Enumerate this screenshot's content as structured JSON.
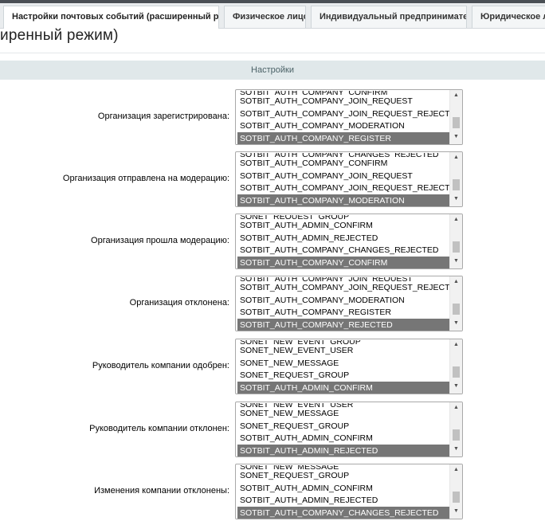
{
  "tabs": [
    {
      "label": "Настройки почтовых событий (расширенный режим)",
      "active": true
    },
    {
      "label": "Физическое лицо",
      "active": false
    },
    {
      "label": "Индивидуальный предприниматель",
      "active": false
    },
    {
      "label": "Юридическое лицо",
      "active": false
    }
  ],
  "page_title": "иренный режим)",
  "section_title": "Настройки",
  "rows": [
    {
      "label": "Организация зарегистрирована:",
      "partial": "SOTBIT_AUTH_COMPANY_CONFIRM",
      "options": [
        "SOTBIT_AUTH_COMPANY_JOIN_REQUEST",
        "SOTBIT_AUTH_COMPANY_JOIN_REQUEST_REJECTED",
        "SOTBIT_AUTH_COMPANY_MODERATION",
        "SOTBIT_AUTH_COMPANY_REGISTER"
      ],
      "selected": "SOTBIT_AUTH_COMPANY_REGISTER"
    },
    {
      "label": "Организация отправлена на модерацию:",
      "partial": "SOTBIT_AUTH_COMPANY_CHANGES_REJECTED",
      "options": [
        "SOTBIT_AUTH_COMPANY_CONFIRM",
        "SOTBIT_AUTH_COMPANY_JOIN_REQUEST",
        "SOTBIT_AUTH_COMPANY_JOIN_REQUEST_REJECTED",
        "SOTBIT_AUTH_COMPANY_MODERATION"
      ],
      "selected": "SOTBIT_AUTH_COMPANY_MODERATION"
    },
    {
      "label": "Организация прошла модерацию:",
      "partial": "SONET_REQUEST_GROUP",
      "options": [
        "SOTBIT_AUTH_ADMIN_CONFIRM",
        "SOTBIT_AUTH_ADMIN_REJECTED",
        "SOTBIT_AUTH_COMPANY_CHANGES_REJECTED",
        "SOTBIT_AUTH_COMPANY_CONFIRM"
      ],
      "selected": "SOTBIT_AUTH_COMPANY_CONFIRM"
    },
    {
      "label": "Организация отклонена:",
      "partial": "SOTBIT_AUTH_COMPANY_JOIN_REQUEST",
      "options": [
        "SOTBIT_AUTH_COMPANY_JOIN_REQUEST_REJECTED",
        "SOTBIT_AUTH_COMPANY_MODERATION",
        "SOTBIT_AUTH_COMPANY_REGISTER",
        "SOTBIT_AUTH_COMPANY_REJECTED"
      ],
      "selected": "SOTBIT_AUTH_COMPANY_REJECTED"
    },
    {
      "label": "Руководитель компании одобрен:",
      "partial": "SONET_NEW_EVENT_GROUP",
      "options": [
        "SONET_NEW_EVENT_USER",
        "SONET_NEW_MESSAGE",
        "SONET_REQUEST_GROUP",
        "SOTBIT_AUTH_ADMIN_CONFIRM"
      ],
      "selected": "SOTBIT_AUTH_ADMIN_CONFIRM"
    },
    {
      "label": "Руководитель компании отклонен:",
      "partial": "SONET_NEW_EVENT_USER",
      "options": [
        "SONET_NEW_MESSAGE",
        "SONET_REQUEST_GROUP",
        "SOTBIT_AUTH_ADMIN_CONFIRM",
        "SOTBIT_AUTH_ADMIN_REJECTED"
      ],
      "selected": "SOTBIT_AUTH_ADMIN_REJECTED"
    },
    {
      "label": "Изменения компании отклонены:",
      "partial": "SONET_NEW_MESSAGE",
      "options": [
        "SONET_REQUEST_GROUP",
        "SOTBIT_AUTH_ADMIN_CONFIRM",
        "SOTBIT_AUTH_ADMIN_REJECTED",
        "SOTBIT_AUTH_COMPANY_CHANGES_REJECTED"
      ],
      "selected": "SOTBIT_AUTH_COMPANY_CHANGES_REJECTED"
    }
  ],
  "icons": {
    "scroll_up": "triangle-up-icon",
    "scroll_down": "triangle-down-icon"
  },
  "colors": {
    "selected_bg": "#767676",
    "section_bg": "#e0e8ea",
    "tabbar_bg": "#e9ecee"
  }
}
